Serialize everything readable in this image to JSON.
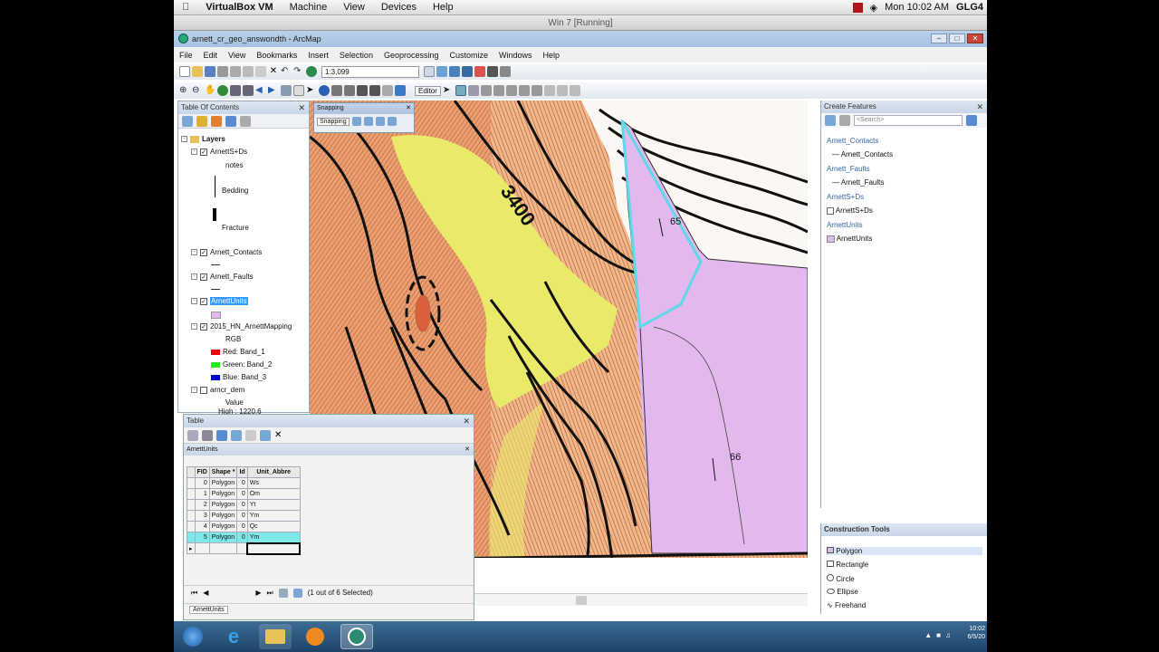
{
  "mac_menubar": {
    "apple": "",
    "items": [
      "VirtualBox VM",
      "Machine",
      "View",
      "Devices",
      "Help"
    ],
    "time": "Mon 10:02 AM",
    "user": "GLG4"
  },
  "vbox_title": "Win 7 [Running]",
  "app_title": "arnett_cr_geo_answondth - ArcMap",
  "menu": [
    "File",
    "Edit",
    "View",
    "Bookmarks",
    "Insert",
    "Selection",
    "Geoprocessing",
    "Customize",
    "Windows",
    "Help"
  ],
  "toolbar": {
    "scale": "1:3,099",
    "editor_label": "Editor"
  },
  "toc": {
    "title": "Table Of Contents",
    "root": "Layers",
    "layers": [
      {
        "name": "ArnettS+Ds",
        "sub": [
          "notes",
          "Bedding",
          "Fracture"
        ]
      },
      {
        "name": "Arnett_Contacts"
      },
      {
        "name": "Arnett_Faults"
      },
      {
        "name": "ArnettUnits"
      },
      {
        "name": "2015_HN_ArnettMapping",
        "sub": [
          "RGB",
          "Red: Band_1",
          "Green: Band_2",
          "Blue: Band_3"
        ]
      },
      {
        "name": "arncr_dem",
        "sub": [
          "Value",
          "High : 1220.6"
        ]
      }
    ]
  },
  "snapping": {
    "title": "Snapping",
    "label": "Snapping"
  },
  "map": {
    "labels": [
      "65",
      "66",
      "3400"
    ],
    "colors": {
      "polygon": "#e3b8ee",
      "selection": "#5fd8e8",
      "yellow": "#e9ea6a",
      "orange": "#e39458"
    }
  },
  "create_features": {
    "title": "Create Features",
    "search_placeholder": "<Search>",
    "groups": [
      {
        "group": "Arnett_Contacts",
        "item": "Arnett_Contacts"
      },
      {
        "group": "Arnett_Faults",
        "item": "Arnett_Faults"
      },
      {
        "group": "ArnettS+Ds",
        "item": "ArnettS+Ds"
      },
      {
        "group": "ArnettUnits",
        "item": "ArnettUnits"
      }
    ]
  },
  "construction_tools": {
    "title": "Construction Tools",
    "items": [
      "Polygon",
      "Rectangle",
      "Circle",
      "Ellipse",
      "Freehand"
    ]
  },
  "table": {
    "title": "Table",
    "layer_tab": "ArnettUnits",
    "columns": [
      "FID",
      "Shape *",
      "Id",
      "Unit_Abbre"
    ],
    "rows": [
      [
        "0",
        "Polygon",
        "0",
        "Ws"
      ],
      [
        "1",
        "Polygon",
        "0",
        "Om"
      ],
      [
        "2",
        "Polygon",
        "0",
        "Yt"
      ],
      [
        "3",
        "Polygon",
        "0",
        "Ym"
      ],
      [
        "4",
        "Polygon",
        "0",
        "Qc"
      ],
      [
        "5",
        "Polygon",
        "0",
        "Ym"
      ]
    ],
    "status": "(1 out of 6 Selected)",
    "bottom_tab": "ArnettUnits"
  },
  "taskbar": {
    "clock_time": "10:02",
    "clock_date": "6/5/20"
  }
}
